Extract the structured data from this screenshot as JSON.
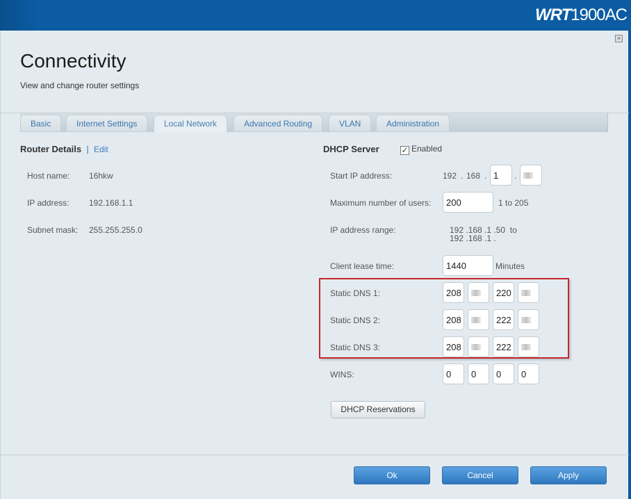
{
  "brand": {
    "bold": "WRT",
    "rest": "1900AC"
  },
  "title": "Connectivity",
  "subtitle": "View and change router settings",
  "tabs": [
    "Basic",
    "Internet Settings",
    "Local Network",
    "Advanced Routing",
    "VLAN",
    "Administration"
  ],
  "router": {
    "heading": "Router Details",
    "edit": "Edit",
    "host_label": "Host name:",
    "host": "16hkw",
    "ip_label": "IP address:",
    "ip": "192.168.1.1",
    "mask_label": "Subnet mask:",
    "mask": "255.255.255.0"
  },
  "dhcp": {
    "heading": "DHCP Server",
    "enabled_label": "Enabled",
    "enabled": true,
    "start_label": "Start IP address:",
    "start_a": "192",
    "start_b": "168",
    "start_c": "1",
    "max_label": "Maximum number of users:",
    "max": "200",
    "max_range": "1 to 205",
    "range_label": "IP address range:",
    "range_start": "192 .168 .1 .50  to",
    "range_end": "192 .168 .1 .",
    "lease_label": "Client lease time:",
    "lease": "1440",
    "lease_unit": "Minutes",
    "dns1_label": "Static DNS 1:",
    "dns1": [
      "208",
      "",
      "220",
      ""
    ],
    "dns2_label": "Static DNS 2:",
    "dns2": [
      "208",
      "",
      "222",
      ""
    ],
    "dns3_label": "Static DNS 3:",
    "dns3": [
      "208",
      "",
      "222",
      ""
    ],
    "wins_label": "WINS:",
    "wins": [
      "0",
      "0",
      "0",
      "0"
    ],
    "reservations": "DHCP Reservations"
  },
  "buttons": {
    "ok": "Ok",
    "cancel": "Cancel",
    "apply": "Apply"
  }
}
